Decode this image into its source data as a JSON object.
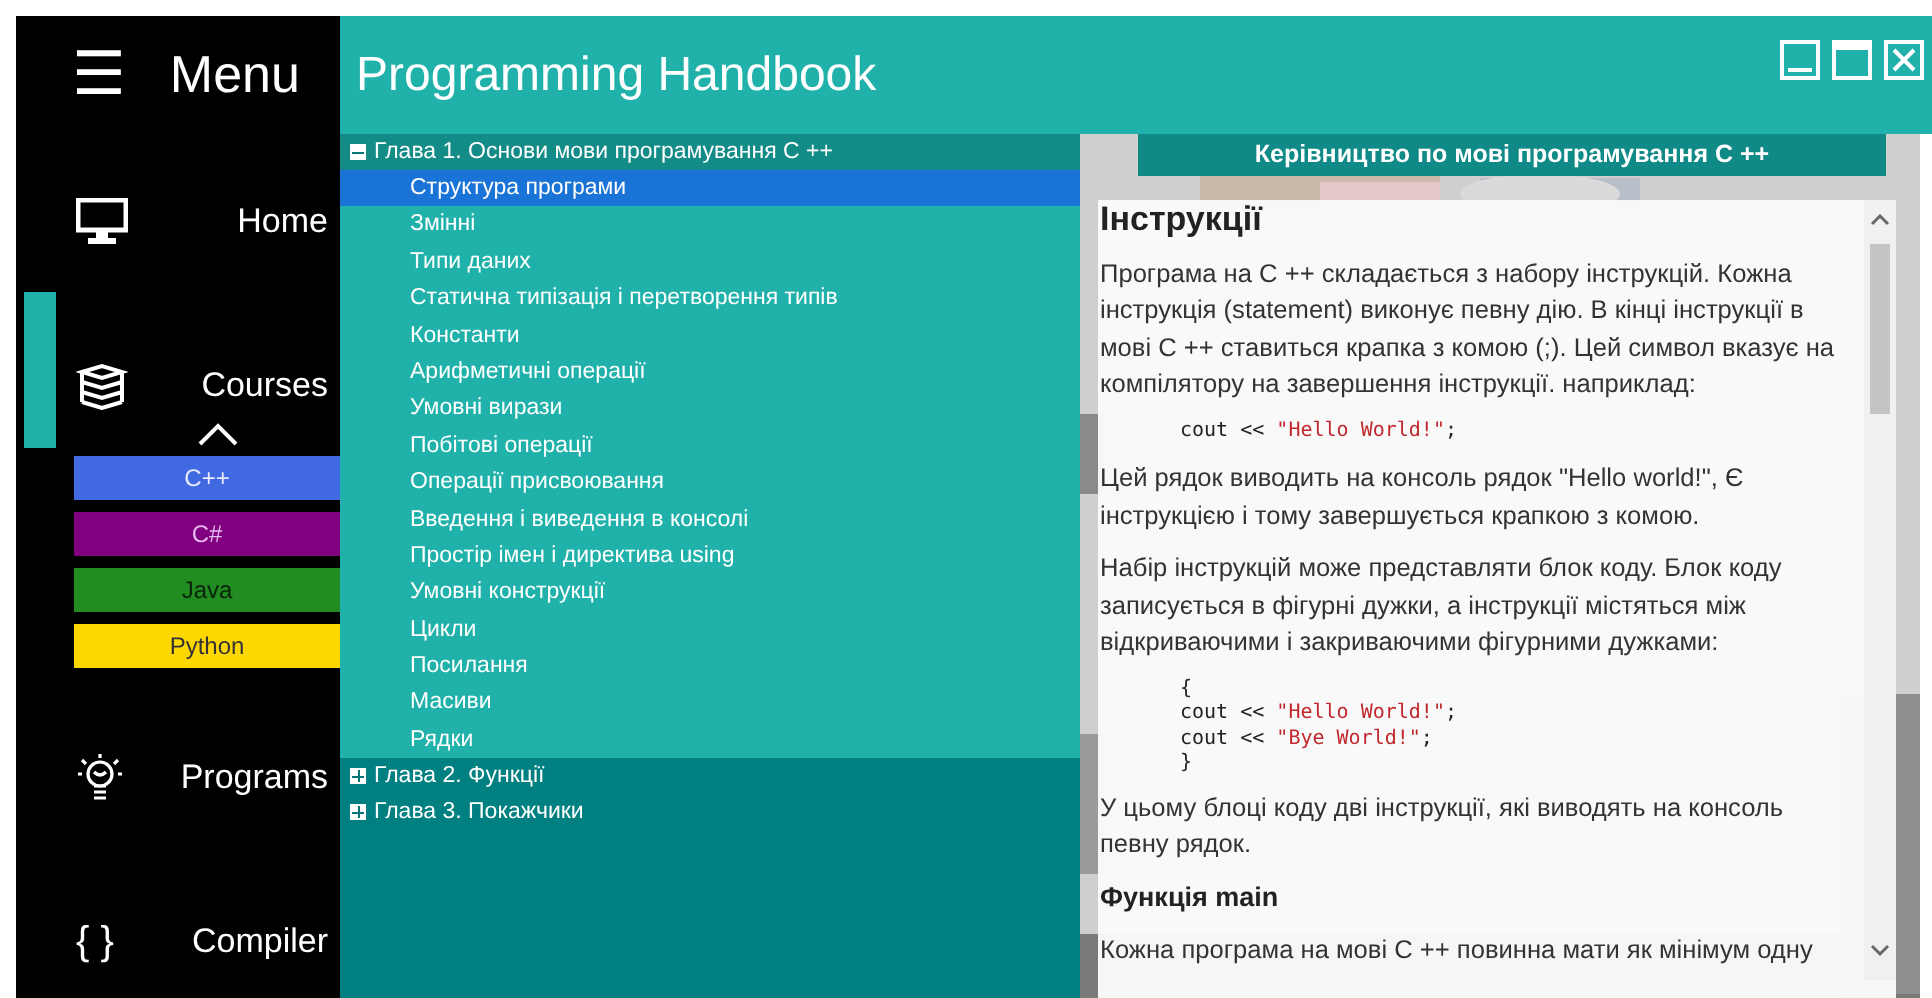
{
  "sidebar": {
    "menu_icon": "☰",
    "title": "Menu",
    "items": [
      {
        "kind": "home",
        "label": "Home",
        "selected": false
      },
      {
        "kind": "courses",
        "label": "Courses",
        "selected": true,
        "expanded": true,
        "courses": [
          {
            "label": "C++",
            "color": "#4169e1"
          },
          {
            "label": "C#",
            "color": "#800080"
          },
          {
            "label": "Java",
            "color": "#228b22"
          },
          {
            "label": "Python",
            "color": "#ffd700"
          }
        ]
      },
      {
        "kind": "programs",
        "label": "Programs",
        "selected": false
      },
      {
        "kind": "compiler",
        "label": "Compiler",
        "selected": false,
        "glyph": "{ }"
      }
    ]
  },
  "header": {
    "title": "Programming Handbook"
  },
  "tree": [
    {
      "label": "Глава 1. Основи мови програмування С ++",
      "expanded": true,
      "children": [
        {
          "label": "Структура програми",
          "selected": true
        },
        {
          "label": "Змінні",
          "selected": false
        },
        {
          "label": "Типи даних",
          "selected": false
        },
        {
          "label": "Статична типізація і перетворення типів",
          "selected": false
        },
        {
          "label": "Константи",
          "selected": false
        },
        {
          "label": "Арифметичні операції",
          "selected": false
        },
        {
          "label": "Умовні вирази",
          "selected": false
        },
        {
          "label": "Побітові операції",
          "selected": false
        },
        {
          "label": "Операції присвоювання",
          "selected": false
        },
        {
          "label": "Введення і виведення в консолі",
          "selected": false
        },
        {
          "label": "Простір імен і директива using",
          "selected": false
        },
        {
          "label": "Умовні конструкції",
          "selected": false
        },
        {
          "label": "Цикли",
          "selected": false
        },
        {
          "label": "Посилання",
          "selected": false
        },
        {
          "label": "Масиви",
          "selected": false
        },
        {
          "label": "Рядки",
          "selected": false
        }
      ]
    },
    {
      "label": "Глава 2. Функції",
      "expanded": false
    },
    {
      "label": "Глава 3. Покажчики",
      "expanded": false
    }
  ],
  "article": {
    "banner": "Керівництво по мові програмування С ++",
    "blocks": [
      {
        "kind": "heading",
        "text": "Інструкції"
      },
      {
        "kind": "paragraph",
        "text": "Програма на С ++ складається з набору інструкцій. Кожна інструкція (statement) виконує певну дію. В кінці інструкції в мові C ++ ставиться крапка з комою (;). Цей символ вказує на компілятору на завершення інструкції. наприклад:"
      },
      {
        "kind": "code",
        "lines": [
          [
            {
              "kind": "plain",
              "text": "cout << "
            },
            {
              "kind": "string",
              "text": "\"Hello World!\""
            },
            {
              "kind": "plain",
              "text": ";"
            }
          ]
        ]
      },
      {
        "kind": "paragraph",
        "text": "Цей рядок виводить на консоль рядок \"Hello world!\", Є інструкцією і тому завершується крапкою з комою."
      },
      {
        "kind": "paragraph",
        "text": "Набір інструкцій може представляти блок коду. Блок коду записується в фігурні дужки, а інструкції містяться між відкриваючими і закриваючими фігурними дужками:"
      },
      {
        "kind": "code",
        "lines": [
          [
            {
              "kind": "plain",
              "text": "{"
            }
          ],
          [
            {
              "kind": "plain",
              "text": "cout << "
            },
            {
              "kind": "string",
              "text": "\"Hello World!\""
            },
            {
              "kind": "plain",
              "text": ";"
            }
          ],
          [
            {
              "kind": "plain",
              "text": "cout << "
            },
            {
              "kind": "string",
              "text": "\"Bye World!\""
            },
            {
              "kind": "plain",
              "text": ";"
            }
          ],
          [
            {
              "kind": "plain",
              "text": "}"
            }
          ]
        ]
      },
      {
        "kind": "paragraph",
        "text": "У цьому блоці коду дві інструкції, які виводять на консоль певну рядок."
      },
      {
        "kind": "subheading",
        "text": "Функція main"
      },
      {
        "kind": "paragraph",
        "text": "Кожна програма на мові С ++ повинна мати як мінімум одну"
      }
    ]
  }
}
